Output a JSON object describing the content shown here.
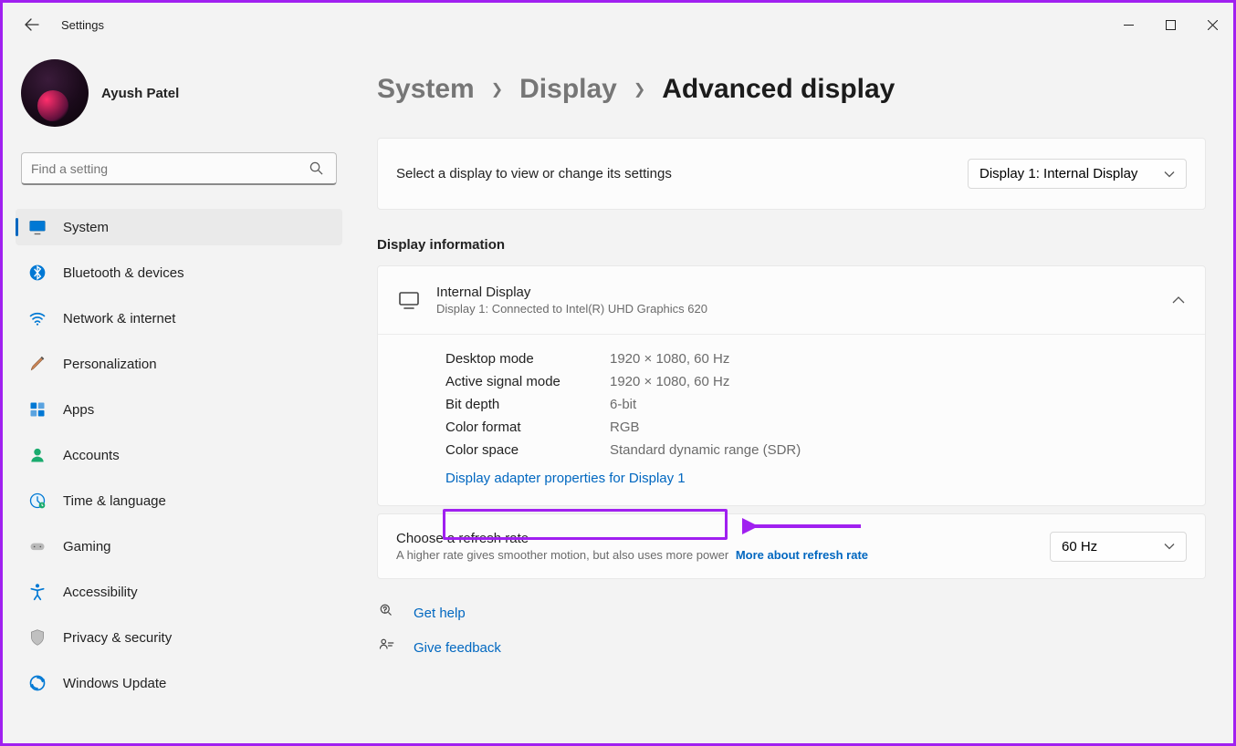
{
  "window": {
    "title": "Settings"
  },
  "profile": {
    "name": "Ayush Patel"
  },
  "search": {
    "placeholder": "Find a setting"
  },
  "nav": [
    {
      "label": "System",
      "icon": "system",
      "active": true
    },
    {
      "label": "Bluetooth & devices",
      "icon": "bluetooth"
    },
    {
      "label": "Network & internet",
      "icon": "wifi"
    },
    {
      "label": "Personalization",
      "icon": "brush"
    },
    {
      "label": "Apps",
      "icon": "apps"
    },
    {
      "label": "Accounts",
      "icon": "person"
    },
    {
      "label": "Time & language",
      "icon": "clock"
    },
    {
      "label": "Gaming",
      "icon": "gamepad"
    },
    {
      "label": "Accessibility",
      "icon": "accessibility"
    },
    {
      "label": "Privacy & security",
      "icon": "shield"
    },
    {
      "label": "Windows Update",
      "icon": "update"
    }
  ],
  "breadcrumb": {
    "items": [
      "System",
      "Display"
    ],
    "current": "Advanced display"
  },
  "select_display": {
    "label": "Select a display to view or change its settings",
    "value": "Display 1: Internal Display"
  },
  "section_title": "Display information",
  "display_info": {
    "name": "Internal Display",
    "subtitle": "Display 1: Connected to Intel(R) UHD Graphics 620",
    "rows": [
      {
        "k": "Desktop mode",
        "v": "1920 × 1080, 60 Hz"
      },
      {
        "k": "Active signal mode",
        "v": "1920 × 1080, 60 Hz"
      },
      {
        "k": "Bit depth",
        "v": "6-bit"
      },
      {
        "k": "Color format",
        "v": "RGB"
      },
      {
        "k": "Color space",
        "v": "Standard dynamic range (SDR)"
      }
    ],
    "adapter_link": "Display adapter properties for Display 1"
  },
  "refresh": {
    "title": "Choose a refresh rate",
    "subtitle": "A higher rate gives smoother motion, but also uses more power",
    "link": "More about refresh rate",
    "value": "60 Hz"
  },
  "footer": {
    "help": "Get help",
    "feedback": "Give feedback"
  }
}
